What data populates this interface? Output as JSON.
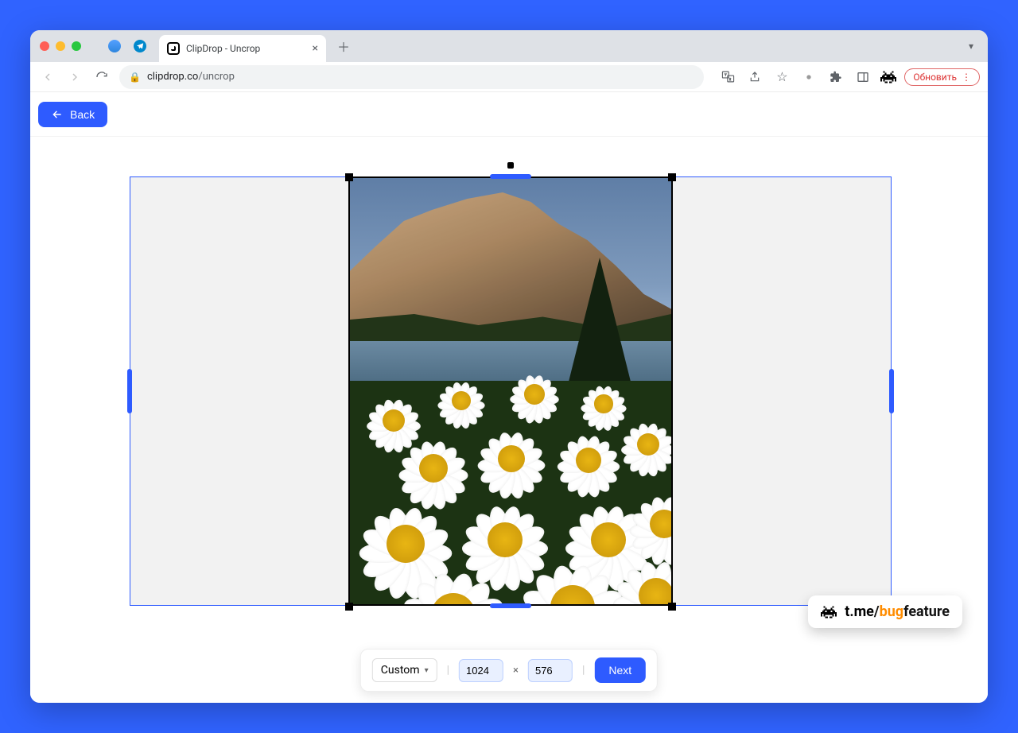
{
  "browser": {
    "tab_title": "ClipDrop - Uncrop",
    "url_host": "clipdrop.co",
    "url_path": "/uncrop",
    "update_label": "Обновить"
  },
  "header": {
    "back_label": "Back"
  },
  "controls": {
    "preset_label": "Custom",
    "width_value": "1024",
    "height_value": "576",
    "next_label": "Next"
  },
  "watermark": {
    "prefix": "t.me",
    "slash": "/",
    "word1": "bug",
    "word2": "feature"
  }
}
